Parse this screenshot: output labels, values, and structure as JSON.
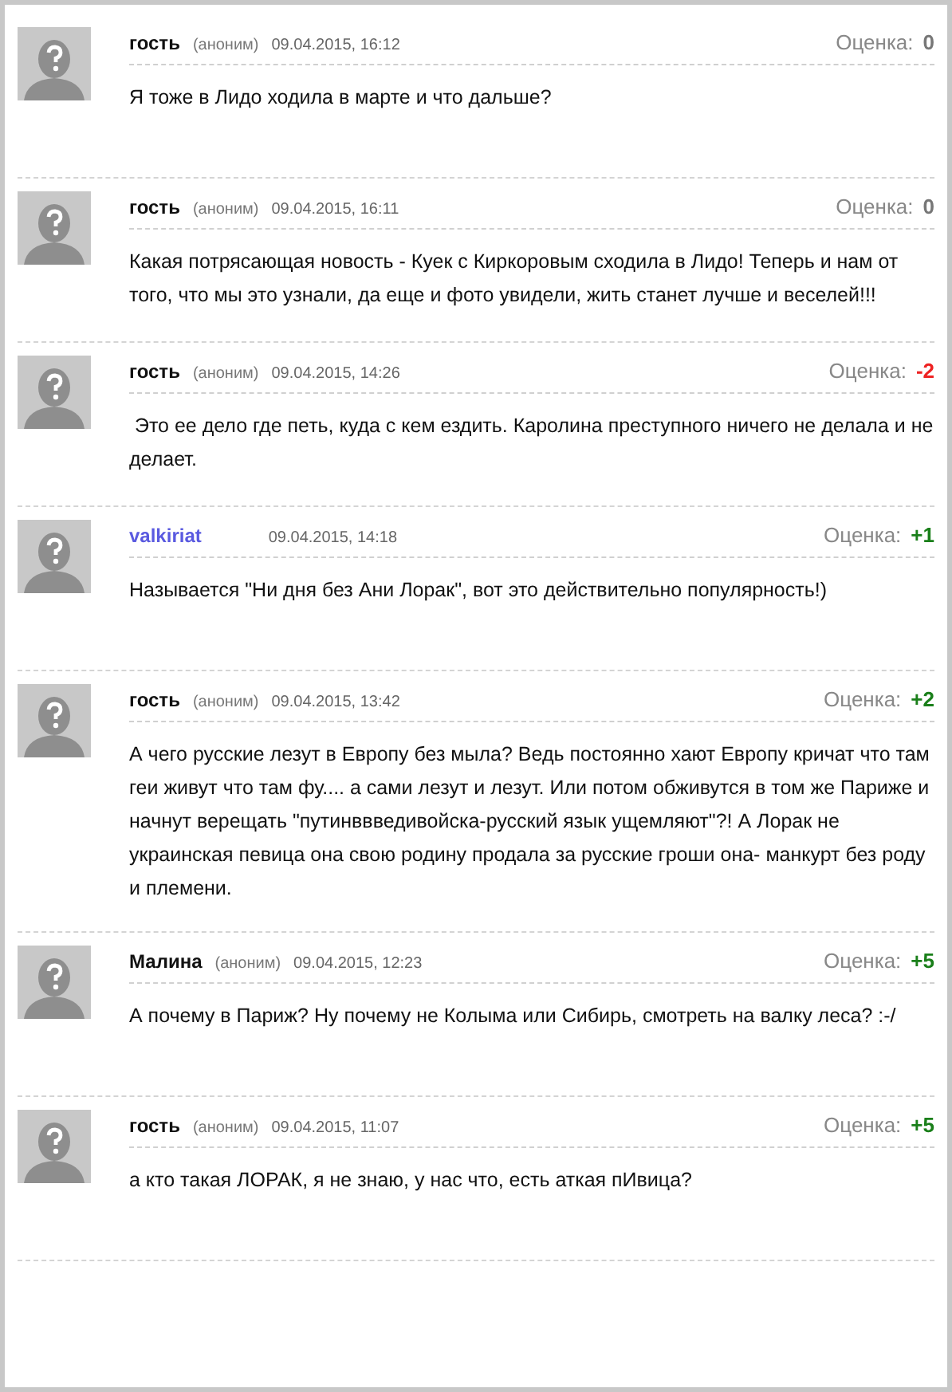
{
  "comments": [
    {
      "author": "гость",
      "registered": false,
      "anon_tag": "(аноним)",
      "date": "09.04.2015, 16:12",
      "score_label": "Оценка:",
      "score": "0",
      "color": "#777777",
      "text": "Я тоже в Лидо ходила в марте и что дальше?"
    },
    {
      "author": "гость",
      "registered": false,
      "anon_tag": "(аноним)",
      "date": "09.04.2015, 16:11",
      "score_label": "Оценка:",
      "score": "0",
      "color": "#777777",
      "text": "Какая потрясающая новость - Куек с Киркоровым сходила в Лидо! Теперь и нам от того, что мы это узнали, да еще и фото увидели, жить станет лучше и веселей!!!"
    },
    {
      "author": "гость",
      "registered": false,
      "anon_tag": "(аноним)",
      "date": "09.04.2015, 14:26",
      "score_label": "Оценка:",
      "score": "-2",
      "color": "#ee2222",
      "text": " Это ее дело где петь, куда с кем ездить. Каролина преступного ничего не делала и не делает."
    },
    {
      "author": "valkiriat",
      "registered": true,
      "date": "09.04.2015, 14:18",
      "score_label": "Оценка:",
      "score": "+1",
      "color": "#1a7f1a",
      "text": "Называется \"Ни дня без Ани Лорак\", вот это действительно популярность!)"
    },
    {
      "author": "гость",
      "registered": false,
      "anon_tag": "(аноним)",
      "date": "09.04.2015, 13:42",
      "score_label": "Оценка:",
      "score": "+2",
      "color": "#1a7f1a",
      "text": "А чего русские лезут в Европу без мыла? Ведь постоянно хают Европу кричат что там геи живут что там фу.... а сами лезут и лезут. Или потом обживутся в том же Париже и начнут верещать \"путинввведивойска-русский язык ущемляют\"?! А Лорак не украинская певица она свою родину продала за русские гроши она- манкурт без роду и племени."
    },
    {
      "author": "Малина",
      "registered": false,
      "anon_tag": "(аноним)",
      "date": "09.04.2015, 12:23",
      "score_label": "Оценка:",
      "score": "+5",
      "color": "#1a7f1a",
      "text": "А почему в Париж? Ну почему не Колыма или Сибирь, смотреть на валку леса? :-/"
    },
    {
      "author": "гость",
      "registered": false,
      "anon_tag": "(аноним)",
      "date": "09.04.2015, 11:07",
      "score_label": "Оценка:",
      "score": "+5",
      "color": "#1a7f1a",
      "text": "а кто такая ЛОРАК, я не знаю, у нас что, есть аткая пИвица?"
    }
  ]
}
